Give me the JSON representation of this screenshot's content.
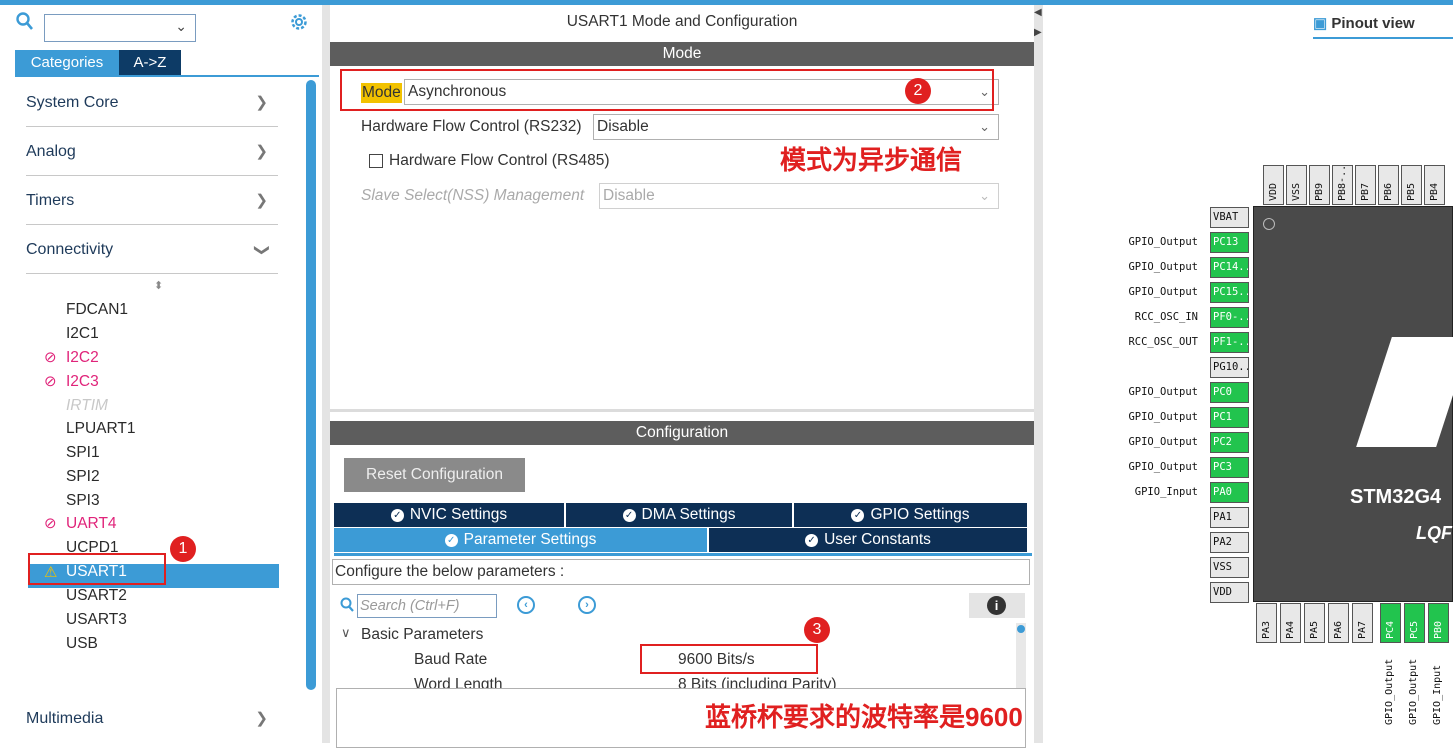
{
  "top_search": {
    "value": ""
  },
  "left_tabs": {
    "categories": "Categories",
    "az": "A->Z"
  },
  "categories": [
    {
      "label": "System Core"
    },
    {
      "label": "Analog"
    },
    {
      "label": "Timers"
    },
    {
      "label": "Connectivity"
    },
    {
      "label": "Multimedia"
    }
  ],
  "peripherals": [
    {
      "label": "FDCAN1",
      "state": "normal"
    },
    {
      "label": "I2C1",
      "state": "normal"
    },
    {
      "label": "I2C2",
      "state": "disabled"
    },
    {
      "label": "I2C3",
      "state": "disabled"
    },
    {
      "label": "IRTIM",
      "state": "ghost"
    },
    {
      "label": "LPUART1",
      "state": "normal"
    },
    {
      "label": "SPI1",
      "state": "normal"
    },
    {
      "label": "SPI2",
      "state": "normal"
    },
    {
      "label": "SPI3",
      "state": "normal"
    },
    {
      "label": "UART4",
      "state": "disabled"
    },
    {
      "label": "UCPD1",
      "state": "normal"
    },
    {
      "label": "USART1",
      "state": "selected-warning"
    },
    {
      "label": "USART2",
      "state": "normal"
    },
    {
      "label": "USART3",
      "state": "normal"
    },
    {
      "label": "USB",
      "state": "normal"
    }
  ],
  "center": {
    "title": "USART1 Mode and Configuration",
    "mode_header": "Mode",
    "mode_label": "Mode",
    "mode_value": "Asynchronous",
    "hw_flow_232_label": "Hardware Flow Control (RS232)",
    "hw_flow_232_value": "Disable",
    "hw_flow_485_label": "Hardware Flow Control (RS485)",
    "slave_select_label": "Slave Select(NSS) Management",
    "slave_select_value": "Disable",
    "config_header": "Configuration",
    "reset_button": "Reset Configuration",
    "tabs": {
      "nvic": "NVIC Settings",
      "dma": "DMA Settings",
      "gpio": "GPIO Settings",
      "params": "Parameter Settings",
      "user_const": "User Constants"
    },
    "configure_text": "Configure the below parameters :",
    "search_placeholder": "Search (Ctrl+F)",
    "basic_params": "Basic Parameters",
    "baud_rate_label": "Baud Rate",
    "baud_rate_value": "9600 Bits/s",
    "word_length_label": "Word Length",
    "word_length_value": "8 Bits (including Parity)"
  },
  "annotations": {
    "badge1": "1",
    "badge2": "2",
    "badge3": "3",
    "note_mode": "模式为异步通信",
    "note_baud": "蓝桥杯要求的波特率是9600"
  },
  "pinout": {
    "view_label": "Pinout view",
    "chip_name": "STM32G4",
    "chip_package": "LQF",
    "left_pins": [
      {
        "pin": "VBAT",
        "label": "",
        "green": false
      },
      {
        "pin": "PC13",
        "label": "GPIO_Output",
        "green": true
      },
      {
        "pin": "PC14..",
        "label": "GPIO_Output",
        "green": true
      },
      {
        "pin": "PC15..",
        "label": "GPIO_Output",
        "green": true
      },
      {
        "pin": "PF0-..",
        "label": "RCC_OSC_IN",
        "green": true
      },
      {
        "pin": "PF1-..",
        "label": "RCC_OSC_OUT",
        "green": true
      },
      {
        "pin": "PG10..",
        "label": "",
        "green": false
      },
      {
        "pin": "PC0",
        "label": "GPIO_Output",
        "green": true
      },
      {
        "pin": "PC1",
        "label": "GPIO_Output",
        "green": true
      },
      {
        "pin": "PC2",
        "label": "GPIO_Output",
        "green": true
      },
      {
        "pin": "PC3",
        "label": "GPIO_Output",
        "green": true
      },
      {
        "pin": "PA0",
        "label": "GPIO_Input",
        "green": true
      },
      {
        "pin": "PA1",
        "label": "",
        "green": false
      },
      {
        "pin": "PA2",
        "label": "",
        "green": false
      },
      {
        "pin": "VSS",
        "label": "",
        "green": false
      },
      {
        "pin": "VDD",
        "label": "",
        "green": false
      }
    ],
    "top_pins": [
      "VDD",
      "VSS",
      "PB9",
      "PB8-..",
      "PB7",
      "PB6",
      "PB5",
      "PB4"
    ],
    "bottom_pins": [
      {
        "pin": "PA3",
        "green": false
      },
      {
        "pin": "PA4",
        "green": false
      },
      {
        "pin": "PA5",
        "green": false
      },
      {
        "pin": "PA6",
        "green": false
      },
      {
        "pin": "PA7",
        "green": false
      },
      {
        "pin": "PC4",
        "green": true,
        "label": "GPIO_Output"
      },
      {
        "pin": "PC5",
        "green": true,
        "label": "GPIO_Output"
      },
      {
        "pin": "PB0",
        "green": true,
        "label": "GPIO_Input"
      }
    ]
  }
}
